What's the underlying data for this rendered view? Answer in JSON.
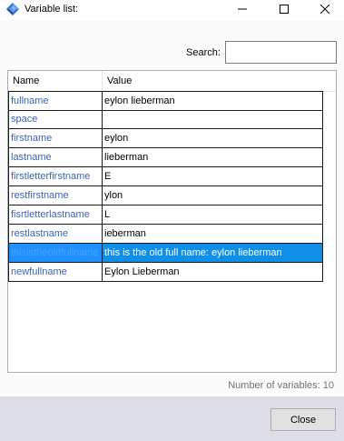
{
  "window": {
    "title": "Variable list:"
  },
  "search": {
    "label": "Search:",
    "value": "",
    "placeholder": ""
  },
  "grid": {
    "columns": [
      "Name",
      "Value"
    ],
    "rows": [
      {
        "name": "fullname",
        "value": "eylon lieberman"
      },
      {
        "name": "space",
        "value": ""
      },
      {
        "name": "firstname",
        "value": "eylon"
      },
      {
        "name": "lastname",
        "value": "lieberman"
      },
      {
        "name": "firstletterfirstname",
        "value": "E"
      },
      {
        "name": "restfirstname",
        "value": "ylon"
      },
      {
        "name": "fisrtletterlastname",
        "value": "L"
      },
      {
        "name": "restlastname",
        "value": "ieberman"
      },
      {
        "name": "thisistheoldfullname",
        "value": "this is the old full name: eylon lieberman",
        "selected": true
      },
      {
        "name": "newfullname",
        "value": "Eylon Lieberman"
      }
    ]
  },
  "status": {
    "count_text": "Number of variables: 10"
  },
  "footer": {
    "close_label": "Close"
  },
  "colors": {
    "selection": "#0f8fe8",
    "name_text": "#3b64b4",
    "footer_bg": "#dcdde6"
  }
}
